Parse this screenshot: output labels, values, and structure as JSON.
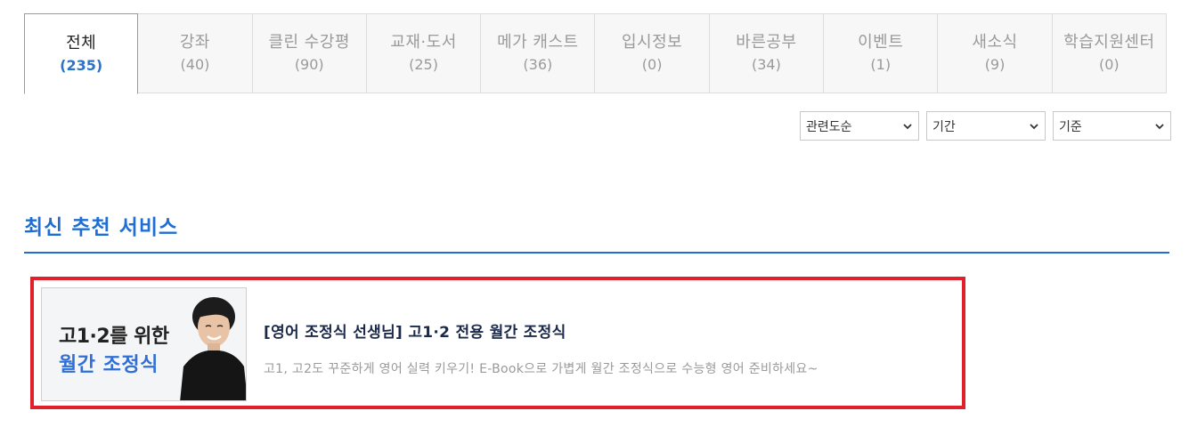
{
  "tabs": [
    {
      "label": "전체",
      "count": "(235)"
    },
    {
      "label": "강좌",
      "count": "(40)"
    },
    {
      "label": "클린 수강평",
      "count": "(90)"
    },
    {
      "label": "교재·도서",
      "count": "(25)"
    },
    {
      "label": "메가 캐스트",
      "count": "(36)"
    },
    {
      "label": "입시정보",
      "count": "(0)"
    },
    {
      "label": "바른공부",
      "count": "(34)"
    },
    {
      "label": "이벤트",
      "count": "(1)"
    },
    {
      "label": "새소식",
      "count": "(9)"
    },
    {
      "label": "학습지원센터",
      "count": "(0)"
    }
  ],
  "filters": {
    "sort": "관련도순",
    "period": "기간",
    "criteria": "기준"
  },
  "section": {
    "title": "최신 추천 서비스"
  },
  "card": {
    "thumb_line1": "고1·2를 위한",
    "thumb_line2": "월간 조정식",
    "title": "[영어 조정식 선생님] 고1·2 전용 월간 조정식",
    "description": "고1, 고2도 꾸준하게 영어 실력 키우기! E-Book으로 가볍게 월간 조정식으로 수능형 영어 준비하세요~"
  },
  "colors": {
    "accent": "#1f6ed4",
    "active_count": "#2a73c9",
    "highlight_border": "#e0202a"
  },
  "icons": {
    "select_arrow": "chevron-down-icon"
  }
}
